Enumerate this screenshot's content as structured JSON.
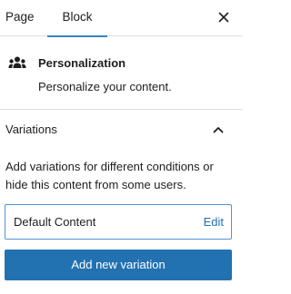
{
  "tabs": [
    {
      "label": "Page",
      "active": false
    },
    {
      "label": "Block",
      "active": true
    }
  ],
  "close_icon": "close-icon",
  "block": {
    "icon": "people-group-icon",
    "title": "Personalization",
    "description": "Personalize your content."
  },
  "variations_panel": {
    "title": "Variations",
    "expanded": true,
    "description": "Add variations for different conditions or hide this content from some users.",
    "items": [
      {
        "name": "Default Content",
        "action": "Edit"
      }
    ],
    "add_button_label": "Add new variation"
  },
  "colors": {
    "accent": "#2271b1",
    "tab_indicator": "#3582c4",
    "border": "#e0e0e0"
  }
}
